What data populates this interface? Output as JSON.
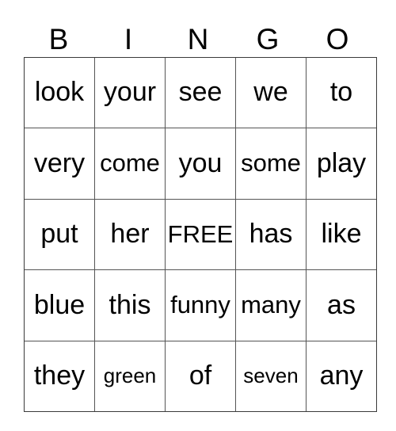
{
  "card": {
    "title_letters": [
      "B",
      "I",
      "N",
      "G",
      "O"
    ],
    "free_space_label": "FREE",
    "grid": [
      [
        "look",
        "your",
        "see",
        "we",
        "to"
      ],
      [
        "very",
        "come",
        "you",
        "some",
        "play"
      ],
      [
        "put",
        "her",
        "FREE",
        "has",
        "like"
      ],
      [
        "blue",
        "this",
        "funny",
        "many",
        "as"
      ],
      [
        "they",
        "green",
        "of",
        "seven",
        "any"
      ]
    ],
    "text_color": "#000000",
    "grid_line_color": "#555555",
    "background_color": "#ffffff"
  }
}
